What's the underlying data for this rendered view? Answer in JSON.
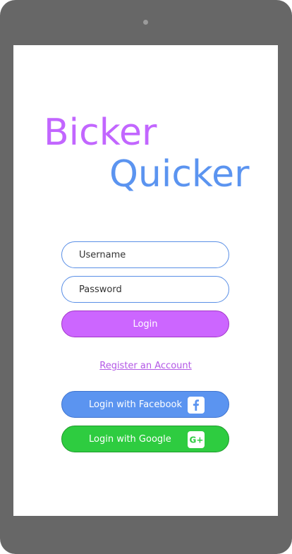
{
  "app": {
    "logo_line1": "Bicker",
    "logo_line2": "Quicker"
  },
  "form": {
    "username_placeholder": "Username",
    "password_placeholder": "Password",
    "login_label": "Login"
  },
  "links": {
    "register_label": "Register an Account"
  },
  "social": {
    "facebook_label": "Login with Facebook",
    "google_label": "Login with Google",
    "facebook_icon": "facebook-icon",
    "google_icon": "google-plus-icon"
  },
  "colors": {
    "brand_purple": "#cc66ff",
    "brand_blue": "#5b94f0",
    "google_green": "#2ecc40",
    "device_frame": "#676767"
  }
}
